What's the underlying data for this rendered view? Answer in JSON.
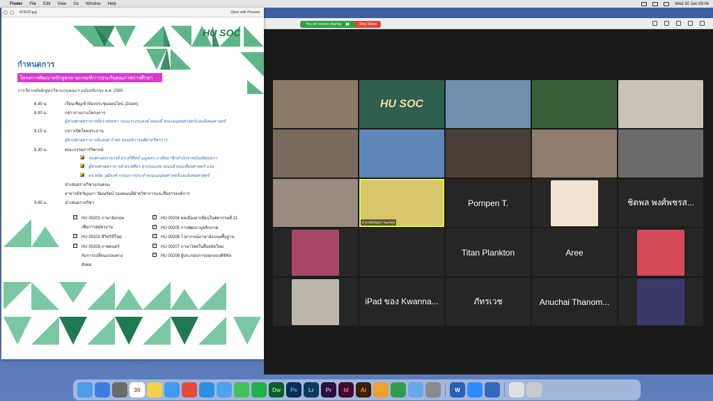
{
  "menubar": {
    "app": "Finder",
    "items": [
      "File",
      "Edit",
      "View",
      "Go",
      "Window",
      "Help"
    ],
    "clock": "Wed 30 Jun 09:04"
  },
  "preview": {
    "filename": "474220.jpg",
    "open_with": "Open with Preview",
    "footer": "ระยะเวลา"
  },
  "doc": {
    "heading": "กำหนดการ",
    "title": "โครงการพัฒนาหลักสูตรตามเกณฑ์การประกันคุณภาพการศึกษา",
    "subtitle": "การวิพากษ์หลักสูตรวิชาแกนคณะฯ ฉบับปรับปรุง พ.ศ. 2565",
    "rows": [
      {
        "time": "8.45 น.",
        "text": "เรียนเชิญเข้าห้องประชุมออนไลน์ (Zoom)"
      },
      {
        "time": "9.00 น.",
        "text": "กล่าวรายงานโครงการ"
      },
      {
        "time": "",
        "text": "ผู้ช่วยศาสตราจารย์ดร.หทยชา วนนะรวงรแดงษ์ คณบดี คณะมนุษยศาสตร์และสังคมศาสตร์",
        "blue": true
      },
      {
        "time": "9.15 น.",
        "text": "กล่าวเปิดโดยประธาน"
      },
      {
        "time": "",
        "text": "ผู้ช่วยศาสตราจารย์แสงศ  กำศร   รองอธิการบดีฝ่ายวิชาการ",
        "blue": true
      },
      {
        "time": "9.30 น.",
        "text": "คณะกรรมการวิพากษ์"
      },
      {
        "time": "",
        "text": "รองศาสตราจารย์ ดร.ศรีศิลป์  บุญขจร        ภาคีสมาชิกสำนักราชบัณฑิตยสภา",
        "bullet": true
      },
      {
        "time": "",
        "text": "ผู้ช่วยศาสตราจารย์ ดร.ศศิธร  สุวรรณเทพ       คณบดี คณะศิลปศาสตร์ มจธ.",
        "bullet": true
      },
      {
        "time": "",
        "text": "ดร.พอัด  วุฒิรงค์           กรรมการประจำคณะมนุษยศาสตร์และสังคมศาสตร์",
        "bullet": true
      },
      {
        "time": "",
        "text": "นำเสนอรายวิชาแกนคณะ"
      },
      {
        "time": "",
        "text": "อาจารย์ชวัญนภา วัฒนรัตน์ รองคณบดีฝ่ายวิชาการและสื่อสารองค์การ"
      },
      {
        "time": "9.45 น.",
        "text": "นำเสนอรายวิชา"
      }
    ],
    "courses_left": [
      "HU 00201 ภาษาอังกฤษ",
      "เพื่อการสมัครงาน",
      "HU 00202 ชีวิตวิถีใหม่",
      "HU 00203 ภาพยนตร์",
      "กับการเปลี่ยนแปลงทาง",
      "สังคม"
    ],
    "courses_right": [
      "HU 00204 พลเมืองอาเซียนในศตวรรษที่ 21",
      "HU 00205 การพัฒนาบุคลิกภาพ",
      "HU 00206 ไวยากรณ์ภาษาอังกฤษพื้นฐาน",
      "HU 00207 ภาษาไทยในสื่อสมัยใหม่",
      "HU 00208 ผู้ประกอบการออกแบบดิจิทัล"
    ],
    "logo": "HU SOC"
  },
  "zoom": {
    "sharing_text": "You are screen sharing",
    "stop_label": "Stop Share",
    "tiles": [
      {
        "label": "",
        "kind": "video"
      },
      {
        "label": "HU SOC",
        "kind": "logo"
      },
      {
        "label": "",
        "kind": "video"
      },
      {
        "label": "",
        "kind": "video"
      },
      {
        "label": "",
        "kind": "video"
      },
      {
        "label": "",
        "kind": "video"
      },
      {
        "label": "",
        "kind": "video"
      },
      {
        "label": "",
        "kind": "video"
      },
      {
        "label": "",
        "kind": "video"
      },
      {
        "label": "",
        "kind": "video"
      },
      {
        "label": "",
        "kind": "video"
      },
      {
        "label": "อาจารย์ขวัญนภา วัฒนรัตน์",
        "kind": "active"
      },
      {
        "label": "Pornpen T.",
        "kind": "name"
      },
      {
        "label": "",
        "kind": "photo"
      },
      {
        "label": "ชิตพล พงศ์พชรส...",
        "kind": "name"
      },
      {
        "label": "",
        "kind": "photo"
      },
      {
        "label": "",
        "kind": "photo-small"
      },
      {
        "label": "Titan Plankton",
        "kind": "name"
      },
      {
        "label": "Aree",
        "kind": "name"
      },
      {
        "label": "",
        "kind": "photo"
      },
      {
        "label": "",
        "kind": "photo"
      },
      {
        "label": "iPad ของ Kwanna...",
        "kind": "name"
      },
      {
        "label": "ภัทรเวช",
        "kind": "name"
      },
      {
        "label": "Anuchai Thanom...",
        "kind": "name"
      },
      {
        "label": "",
        "kind": "photo"
      }
    ]
  },
  "dock": [
    "Finder",
    "Launchpad",
    "Apps",
    "30",
    "Notes",
    "Safari",
    "Chrome",
    "Edge",
    "Mail",
    "Messages",
    "LINE",
    "Dw",
    "Ps",
    "Lr",
    "Pr",
    "Id",
    "Ai",
    "Photos",
    "Numbers",
    "Preview",
    "Settings",
    "W",
    "Zoom",
    "Word",
    "Doc",
    "Trash"
  ]
}
